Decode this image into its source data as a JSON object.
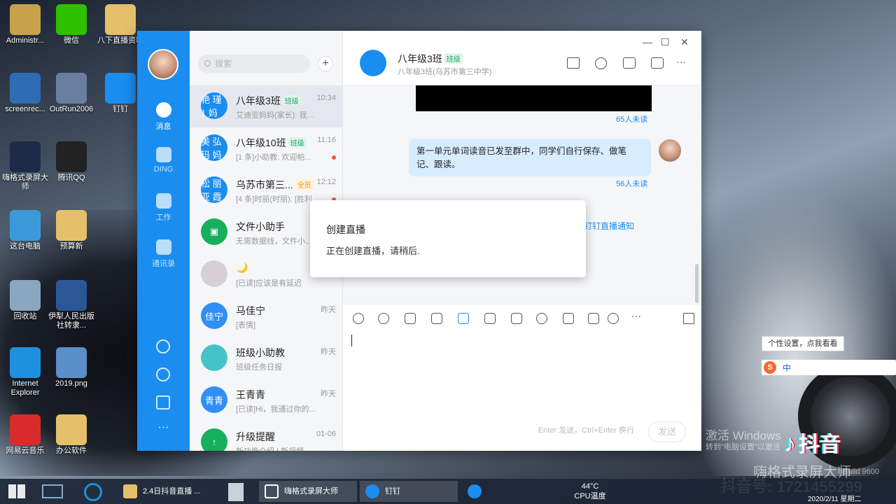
{
  "desktop": {
    "icons": [
      {
        "label": "Administr...",
        "color": "#c8a24a"
      },
      {
        "label": "微信",
        "color": "#2dc100"
      },
      {
        "label": "八下直播资料",
        "color": "#e5c06a"
      },
      {
        "label": "screenrec...",
        "color": "#2e6db3"
      },
      {
        "label": "OutRun2006",
        "color": "#6a7fa0"
      },
      {
        "label": "钉钉",
        "color": "#1a8df0"
      },
      {
        "label": "嗨格式录屏大师",
        "color": "#1d2b48"
      },
      {
        "label": "腾讯QQ",
        "color": "#222222"
      },
      {
        "label": "这台电脑",
        "color": "#3a9ad9"
      },
      {
        "label": "预算新",
        "color": "#e5c06a"
      },
      {
        "label": "回收站",
        "color": "#8aa6c0"
      },
      {
        "label": "伊犁人民出版社转隶...",
        "color": "#2b5797"
      },
      {
        "label": "Internet Explorer",
        "color": "#1e90e0"
      },
      {
        "label": "2019.png",
        "color": "#5b8fc9"
      },
      {
        "label": "网易云音乐",
        "color": "#d92b2b"
      },
      {
        "label": "办公软件",
        "color": "#e5c06a"
      }
    ]
  },
  "app": {
    "rail": {
      "items": [
        {
          "label": "消息",
          "icon": "message-icon"
        },
        {
          "label": "DING",
          "icon": "ding-icon"
        },
        {
          "label": "工作",
          "icon": "work-icon"
        },
        {
          "label": "通讯录",
          "icon": "contacts-icon"
        }
      ],
      "more": "···"
    },
    "search_placeholder": "搜索",
    "add_label": "+",
    "conversations": [
      {
        "name": "八年级3班",
        "tag": "班级",
        "time": "10:34",
        "preview": "艾迪亚妈妈(家长): 我...",
        "avatar_text": "艳 瑾 1 妈",
        "avatar_color": "#1a8df0"
      },
      {
        "name": "八年级10班",
        "tag": "班级",
        "time": "11:16",
        "preview": "[1 条]小助教: 欢迎帕...",
        "avatar_text": "美 弘 玛 妈",
        "avatar_color": "#1a8df0"
      },
      {
        "name": "乌苏市第三...",
        "tag": "全员",
        "time": "12:12",
        "preview": "[4 条]时丽(时丽): [胜利...",
        "avatar_text": "松 丽 亚 霞",
        "avatar_color": "#1a8df0"
      },
      {
        "name": "文件小助手",
        "tag": "",
        "time": "",
        "preview": "无需数据线，文件小...",
        "avatar_text": "▣",
        "avatar_color": "#16b05c"
      },
      {
        "name": "🌙",
        "tag": "",
        "time": "",
        "preview": "[已读]应该是有延迟",
        "avatar_text": "",
        "avatar_color": "#d8cfd6"
      },
      {
        "name": "马佳宁",
        "tag": "",
        "time": "昨天",
        "preview": "[表情]",
        "avatar_text": "佳宁",
        "avatar_color": "#2f8ff5"
      },
      {
        "name": "班级小助教",
        "tag": "",
        "time": "昨天",
        "preview": "班级任务日报",
        "avatar_text": "",
        "avatar_color": "#46c3c9"
      },
      {
        "name": "王青青",
        "tag": "",
        "time": "昨天",
        "preview": "[已读]Hi，我通过你的...",
        "avatar_text": "青青",
        "avatar_color": "#2f8ff5"
      },
      {
        "name": "升级提醒",
        "tag": "",
        "time": "01-06",
        "preview": "新功能介绍 | 新视频...",
        "avatar_text": "↑",
        "avatar_color": "#16b05c"
      }
    ],
    "chat": {
      "title": "八年级3班",
      "tag": "班级",
      "subtitle": "八年级3班(乌苏市第三中学)",
      "unread_1": "65人未读",
      "message": "第一单元单词读音已发至群中，同学们自行保存、做笔记、跟读。",
      "unread_2": "56人未读",
      "live_link": "钉钉直播通知",
      "input_hint": "Enter 发送，Ctrl+Enter 换行",
      "send_label": "发送"
    },
    "window_controls": {
      "min": "—",
      "max": "☐",
      "close": "✕"
    }
  },
  "dialog": {
    "title": "创建直播",
    "message": "正在创建直播，请稍后."
  },
  "tooltip": "个性设置，点我看看",
  "ime": {
    "mode": "中"
  },
  "taskbar": {
    "buttons": [
      {
        "label": "2.4日抖音直播 ...",
        "color": "#e5c06a"
      },
      {
        "label": "嗨格式录屏大师",
        "color": "#222"
      },
      {
        "label": "钉钉",
        "color": "#1a8df0"
      }
    ],
    "temp": "44°C",
    "temp_label": "CPU温度",
    "date": "2020/2/11 星期二"
  },
  "overlay": {
    "activate": "激活 Windows",
    "activate_sub": "转到\"电脑设置\"以激活",
    "build": "Build 9600",
    "tiktok": "抖音",
    "tiktok_id": "抖音号: 1721455299",
    "recorder": "嗨格式录屏大师"
  }
}
